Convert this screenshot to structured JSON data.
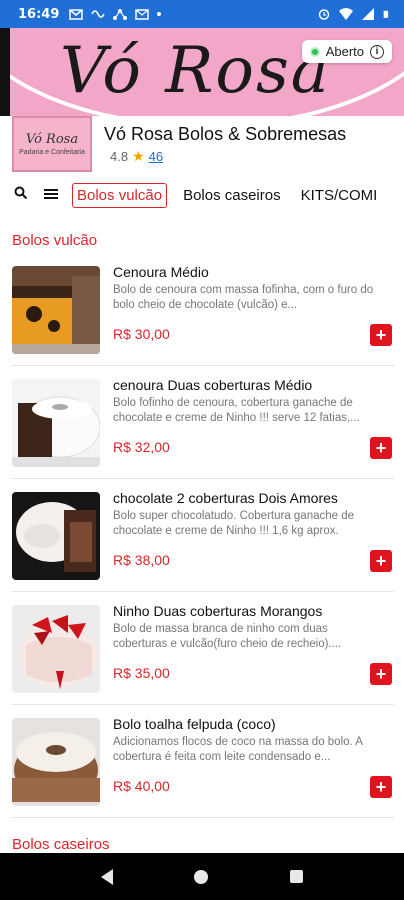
{
  "status_bar": {
    "time": "16:49"
  },
  "banner": {
    "title": "Vó Rosa",
    "status_label": "Aberto"
  },
  "store": {
    "logo_line1": "Vó Rosa",
    "logo_line2": "Padaria e Confeitaria",
    "name": "Vó Rosa Bolos & Sobremesas",
    "rating": "4.8",
    "rating_count": "46"
  },
  "tabs": [
    "Bolos vulcão",
    "Bolos caseiros",
    "KITS/COMI"
  ],
  "sections": {
    "first": "Bolos vulcão",
    "second": "Bolos caseiros"
  },
  "products": [
    {
      "name": "Cenoura Médio",
      "desc": "Bolo de cenoura com massa fofinha, com o furo do bolo cheio de chocolate (vulcão) e...",
      "price": "R$ 30,00"
    },
    {
      "name": "cenoura Duas coberturas Médio",
      "desc": "Bolo fofinho de cenoura, cobertura ganache de chocolate e creme de Ninho !!! serve 12 fatias,...",
      "price": "R$ 32,00"
    },
    {
      "name": "chocolate 2 coberturas Dois Amores",
      "desc": "Bolo super chocolatudo. Cobertura ganache de chocolate e creme de Ninho !!! 1,6 kg aprox.",
      "price": "R$ 38,00"
    },
    {
      "name": "Ninho Duas coberturas Morangos",
      "desc": "Bolo de massa branca de ninho com duas coberturas e vulcão(furo cheio de recheio)....",
      "price": "R$ 35,00"
    },
    {
      "name": "Bolo toalha felpuda (coco)",
      "desc": "Adicionamos flocos de coco na massa do bolo. A cobertura é feita com leite condensado e...",
      "price": "R$ 40,00"
    }
  ],
  "colors": {
    "accent": "#d8262b",
    "status_bar": "#1f6fd6",
    "banner": "#f3a7c8",
    "add_button": "#e0141e"
  }
}
